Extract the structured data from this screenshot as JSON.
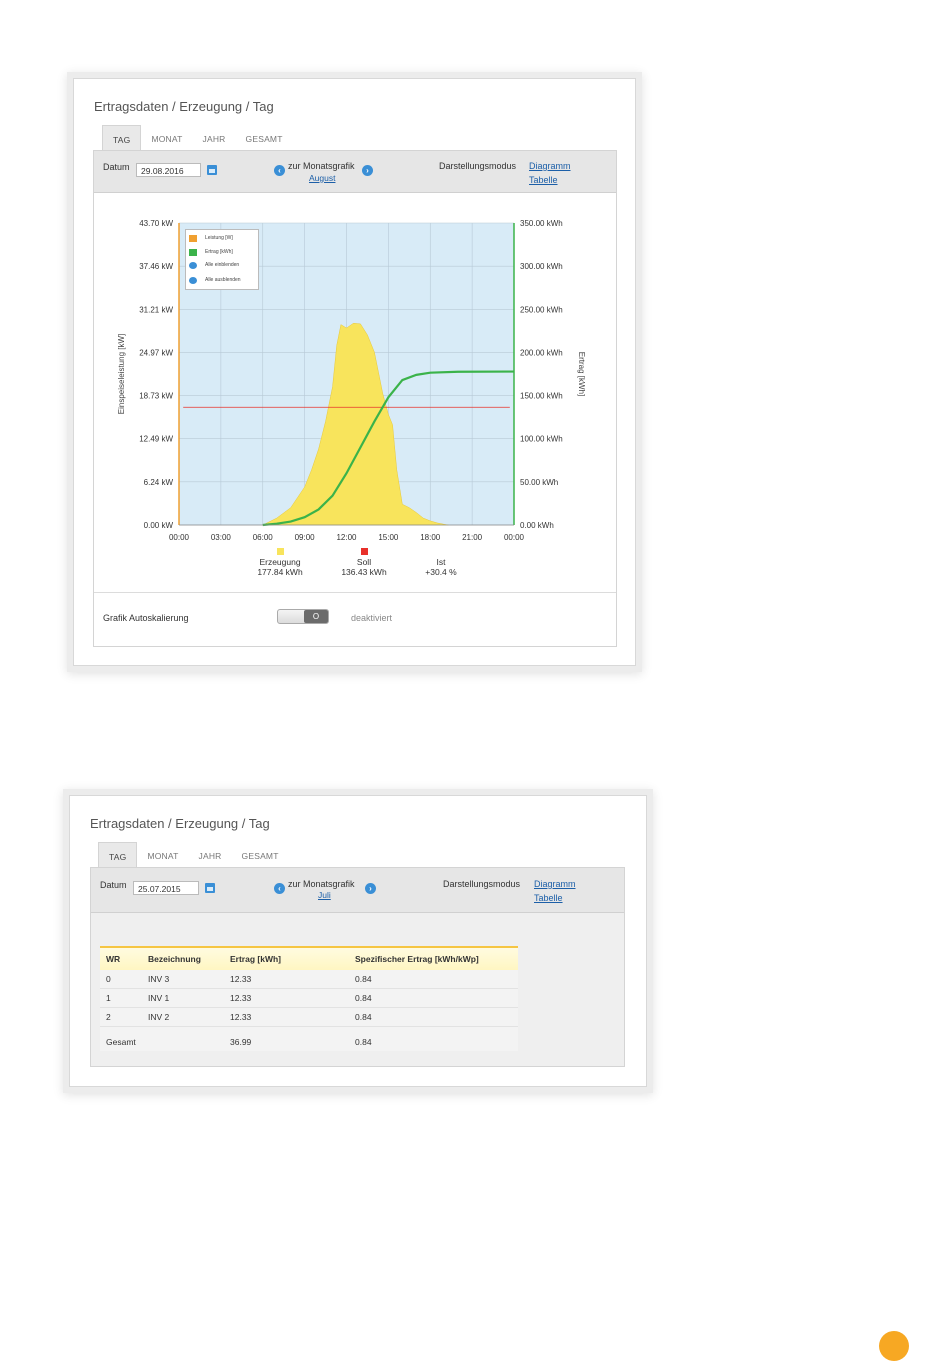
{
  "screenshot1": {
    "title": "Ertragsdaten / Erzeugung / Tag",
    "tabs": [
      "TAG",
      "MONAT",
      "JAHR",
      "GESAMT"
    ],
    "active_tab": "TAG",
    "date_label": "Datum",
    "date_value": "29.08.2016",
    "nav_label": "zur Monatsgrafik",
    "nav_month": "August",
    "mode_label": "Darstellungsmodus",
    "mode_diagram": "Diagramm",
    "mode_table": "Tabelle",
    "autoscale_label": "Grafik Autoskalierung",
    "autoscale_state": "deaktiviert",
    "toggle_symbol": "O",
    "summary": {
      "erzeugung_label": "Erzeugung",
      "erzeugung_value": "177.84 kWh",
      "erzeugung_color": "#f8e45c",
      "soll_label": "Soll",
      "soll_value": "136.43 kWh",
      "soll_color": "#e8302a",
      "ist_label": "Ist",
      "ist_value": "+30.4 %"
    },
    "legend": {
      "leistung": "Leistung [W]",
      "ertrag": "Ertrag [kWh]",
      "show_all": "Alle einblenden",
      "hide_all": "Alle ausblenden"
    }
  },
  "chart_data": {
    "type": "area",
    "title": "",
    "xlabel": "",
    "ylabel": "Einspeiseleistung [kW]",
    "y2label": "Ertrag [kWh]",
    "x_ticks": [
      "00:00",
      "03:00",
      "06:00",
      "09:00",
      "12:00",
      "15:00",
      "18:00",
      "21:00",
      "00:00"
    ],
    "y_ticks": [
      "0.00 kW",
      "6.24 kW",
      "12.49 kW",
      "18.73 kW",
      "24.97 kW",
      "31.21 kW",
      "37.46 kW",
      "43.70 kW"
    ],
    "y2_ticks": [
      "0.00 kWh",
      "50.00 kWh",
      "100.00 kWh",
      "150.00 kWh",
      "200.00 kWh",
      "250.00 kWh",
      "300.00 kWh",
      "350.00 kWh"
    ],
    "xlim_hours": [
      0,
      24
    ],
    "ylim": [
      0,
      43.7
    ],
    "y2lim": [
      0,
      350
    ],
    "grid": true,
    "legend_position": "top-left",
    "colors": {
      "leistung": "#f8e45c",
      "leistung_border": "#f0a030",
      "ertrag": "#3bb34a",
      "soll": "#e8302a",
      "plot_bg": "#d8ebf7"
    },
    "series": [
      {
        "name": "Leistung [W]",
        "x_hours": [
          6.0,
          7.0,
          8.0,
          8.5,
          9.0,
          9.5,
          10.0,
          10.5,
          11.0,
          11.3,
          11.6,
          12.0,
          12.5,
          13.0,
          13.5,
          14.0,
          14.3,
          14.6,
          15.0,
          15.3,
          15.6,
          16.0,
          16.5,
          17.0,
          17.5,
          18.0,
          18.5,
          19.0,
          19.3
        ],
        "values": [
          0.0,
          1.0,
          2.5,
          4.0,
          5.5,
          8.0,
          11.0,
          15.0,
          20.0,
          26.0,
          29.0,
          28.5,
          29.2,
          29.1,
          27.5,
          25.0,
          22.0,
          19.0,
          16.0,
          14.5,
          8.0,
          3.0,
          2.5,
          1.8,
          1.0,
          0.6,
          0.3,
          0.1,
          0.0
        ]
      },
      {
        "name": "Ertrag [kWh]",
        "x_hours": [
          6.0,
          7.0,
          8.0,
          9.0,
          10.0,
          11.0,
          12.0,
          13.0,
          14.0,
          15.0,
          16.0,
          17.0,
          18.0,
          20.0,
          24.0
        ],
        "values": [
          0.0,
          1.5,
          4.0,
          9.0,
          18.0,
          34.0,
          60.0,
          90.0,
          120.0,
          148.0,
          168.0,
          174.0,
          176.5,
          177.6,
          177.84
        ]
      },
      {
        "name": "Soll",
        "x_hours": [
          0.3,
          23.7
        ],
        "values": [
          136.43,
          136.43
        ]
      }
    ]
  },
  "screenshot2": {
    "title": "Ertragsdaten / Erzeugung / Tag",
    "tabs": [
      "TAG",
      "MONAT",
      "JAHR",
      "GESAMT"
    ],
    "active_tab": "TAG",
    "date_label": "Datum",
    "date_value": "25.07.2015",
    "nav_label": "zur Monatsgrafik",
    "nav_month": "Juli",
    "mode_label": "Darstellungsmodus",
    "mode_diagram": "Diagramm",
    "mode_table": "Tabelle",
    "table": {
      "headers": [
        "WR",
        "Bezeichnung",
        "Ertrag [kWh]",
        "Spezifischer Ertrag [kWh/kWp]"
      ],
      "rows": [
        [
          "0",
          "INV 3",
          "12.33",
          "0.84"
        ],
        [
          "1",
          "INV 1",
          "12.33",
          "0.84"
        ],
        [
          "2",
          "INV 2",
          "12.33",
          "0.84"
        ]
      ],
      "total": [
        "Gesamt",
        "",
        "36.99",
        "0.84"
      ]
    }
  }
}
